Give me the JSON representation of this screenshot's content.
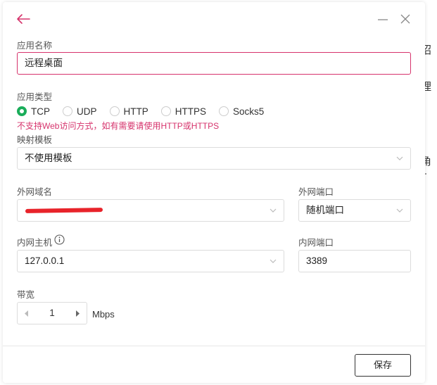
{
  "background": {
    "fragments": [
      "招",
      "理",
      "角+"
    ]
  },
  "dialog": {
    "app_name": {
      "label": "应用名称",
      "value": "远程桌面"
    },
    "app_type": {
      "label": "应用类型",
      "options": [
        "TCP",
        "UDP",
        "HTTP",
        "HTTPS",
        "Socks5"
      ],
      "selected": "TCP",
      "warning": "不支持Web访问方式，如有需要请使用HTTP或HTTPS"
    },
    "template": {
      "label": "映射模板",
      "value": "不使用模板"
    },
    "external_domain": {
      "label": "外网域名",
      "value": ""
    },
    "external_port": {
      "label": "外网端口",
      "value": "随机端口"
    },
    "internal_host": {
      "label": "内网主机",
      "value": "127.0.0.1"
    },
    "internal_port": {
      "label": "内网端口",
      "value": "3389"
    },
    "bandwidth": {
      "label": "带宽",
      "value": "1",
      "unit": "Mbps"
    },
    "save_label": "保存"
  },
  "colors": {
    "accent": "#d6336c",
    "radio_checked": "#1aad5a",
    "redaction": "#e8232a"
  }
}
